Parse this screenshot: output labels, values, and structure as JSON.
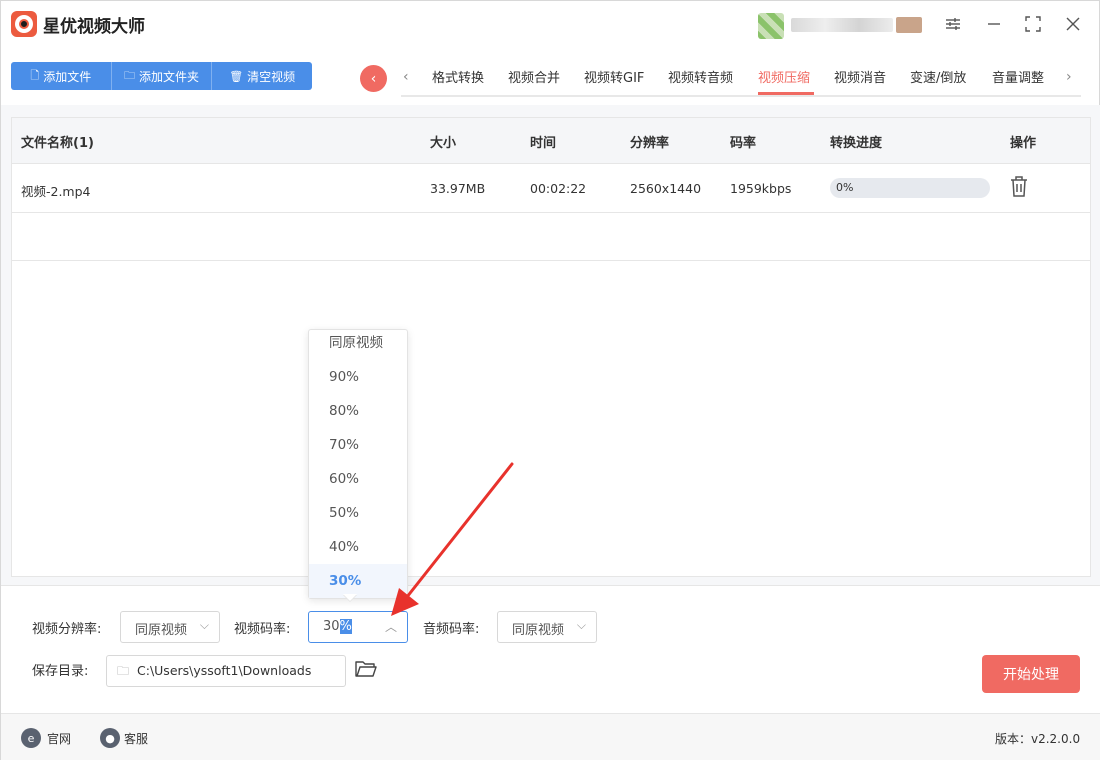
{
  "app": {
    "title": "星优视频大师"
  },
  "window": {
    "controls": [
      "settings-icon",
      "minimize-icon",
      "maximize-icon",
      "close-icon"
    ]
  },
  "toolbar": {
    "add_file": "添加文件",
    "add_folder": "添加文件夹",
    "clear_video": "清空视频"
  },
  "tabs": [
    {
      "label": "格式转换",
      "active": false
    },
    {
      "label": "视频合并",
      "active": false
    },
    {
      "label": "视频转GIF",
      "active": false
    },
    {
      "label": "视频转音频",
      "active": false
    },
    {
      "label": "视频压缩",
      "active": true
    },
    {
      "label": "视频消音",
      "active": false
    },
    {
      "label": "变速/倒放",
      "active": false
    },
    {
      "label": "音量调整",
      "active": false
    }
  ],
  "table": {
    "headers": {
      "name": "文件名称(1)",
      "size": "大小",
      "time": "时间",
      "resolution": "分辨率",
      "bitrate": "码率",
      "progress": "转换进度",
      "action": "操作"
    },
    "rows": [
      {
        "name": "视频-2.mp4",
        "size": "33.97MB",
        "time": "00:02:22",
        "resolution": "2560x1440",
        "bitrate": "1959kbps",
        "progress_text": "0%",
        "progress": 0
      }
    ]
  },
  "settings": {
    "resolution_label": "视频分辨率:",
    "resolution_value": "同原视频",
    "bitrate_label": "视频码率:",
    "bitrate_value_plain": "30",
    "bitrate_value_selected": "%",
    "audio_bitrate_label": "音频码率:",
    "audio_bitrate_value": "同原视频",
    "dir_label": "保存目录:",
    "dir_value": "C:\\Users\\yssoft1\\Downloads",
    "start_button": "开始处理"
  },
  "dropdown": {
    "options": [
      "同原视频",
      "90%",
      "80%",
      "70%",
      "60%",
      "50%",
      "40%",
      "30%"
    ],
    "selected": "30%"
  },
  "footer": {
    "website": "官网",
    "support": "客服",
    "version": "版本：v2.2.0.0"
  },
  "colors": {
    "accent": "#4a8ee8",
    "brand_red": "#f06a62",
    "annotation_arrow": "#e8322c"
  }
}
